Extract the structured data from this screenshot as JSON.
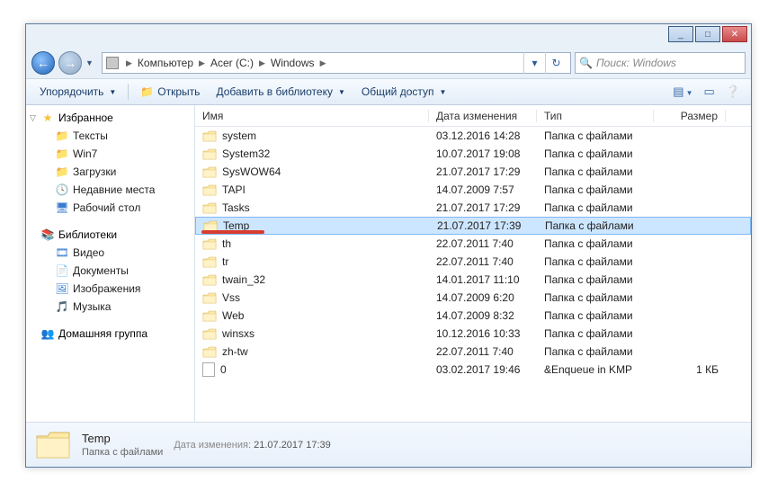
{
  "window": {
    "minimize": "_",
    "maximize": "□",
    "close": "✕"
  },
  "breadcrumbs": [
    "Компьютер",
    "Acer (C:)",
    "Windows"
  ],
  "nav": {
    "refresh_glyph": "↻"
  },
  "search": {
    "placeholder": "Поиск: Windows",
    "glyph": "🔍"
  },
  "toolbar": {
    "organize": "Упорядочить",
    "open": "Открыть",
    "addlib": "Добавить в библиотеку",
    "share": "Общий доступ"
  },
  "navpane": {
    "favorites": {
      "label": "Избранное",
      "items": [
        "Тексты",
        "Win7",
        "Загрузки",
        "Недавние места",
        "Рабочий стол"
      ]
    },
    "libraries": {
      "label": "Библиотеки",
      "items": [
        "Видео",
        "Документы",
        "Изображения",
        "Музыка"
      ]
    },
    "homegroup": {
      "label": "Домашняя группа"
    }
  },
  "columns": {
    "name": "Имя",
    "date": "Дата изменения",
    "type": "Тип",
    "size": "Размер"
  },
  "rows": [
    {
      "kind": "folder",
      "name": "system",
      "date": "03.12.2016 14:28",
      "type": "Папка с файлами",
      "size": ""
    },
    {
      "kind": "folder",
      "name": "System32",
      "date": "10.07.2017 19:08",
      "type": "Папка с файлами",
      "size": ""
    },
    {
      "kind": "folder",
      "name": "SysWOW64",
      "date": "21.07.2017 17:29",
      "type": "Папка с файлами",
      "size": ""
    },
    {
      "kind": "folder",
      "name": "TAPI",
      "date": "14.07.2009 7:57",
      "type": "Папка с файлами",
      "size": ""
    },
    {
      "kind": "folder",
      "name": "Tasks",
      "date": "21.07.2017 17:29",
      "type": "Папка с файлами",
      "size": ""
    },
    {
      "kind": "folder",
      "name": "Temp",
      "date": "21.07.2017 17:39",
      "type": "Папка с файлами",
      "size": "",
      "selected": true,
      "redline": true
    },
    {
      "kind": "folder",
      "name": "th",
      "date": "22.07.2011 7:40",
      "type": "Папка с файлами",
      "size": ""
    },
    {
      "kind": "folder",
      "name": "tr",
      "date": "22.07.2011 7:40",
      "type": "Папка с файлами",
      "size": ""
    },
    {
      "kind": "folder",
      "name": "twain_32",
      "date": "14.01.2017 11:10",
      "type": "Папка с файлами",
      "size": ""
    },
    {
      "kind": "folder",
      "name": "Vss",
      "date": "14.07.2009 6:20",
      "type": "Папка с файлами",
      "size": ""
    },
    {
      "kind": "folder",
      "name": "Web",
      "date": "14.07.2009 8:32",
      "type": "Папка с файлами",
      "size": ""
    },
    {
      "kind": "folder",
      "name": "winsxs",
      "date": "10.12.2016 10:33",
      "type": "Папка с файлами",
      "size": ""
    },
    {
      "kind": "folder",
      "name": "zh-tw",
      "date": "22.07.2011 7:40",
      "type": "Папка с файлами",
      "size": ""
    },
    {
      "kind": "file",
      "name": "0",
      "date": "03.02.2017 19:46",
      "type": "&Enqueue in KMP",
      "size": "1 КБ"
    }
  ],
  "details": {
    "name": "Temp",
    "type": "Папка с файлами",
    "date_label": "Дата изменения:",
    "date": "21.07.2017 17:39"
  }
}
